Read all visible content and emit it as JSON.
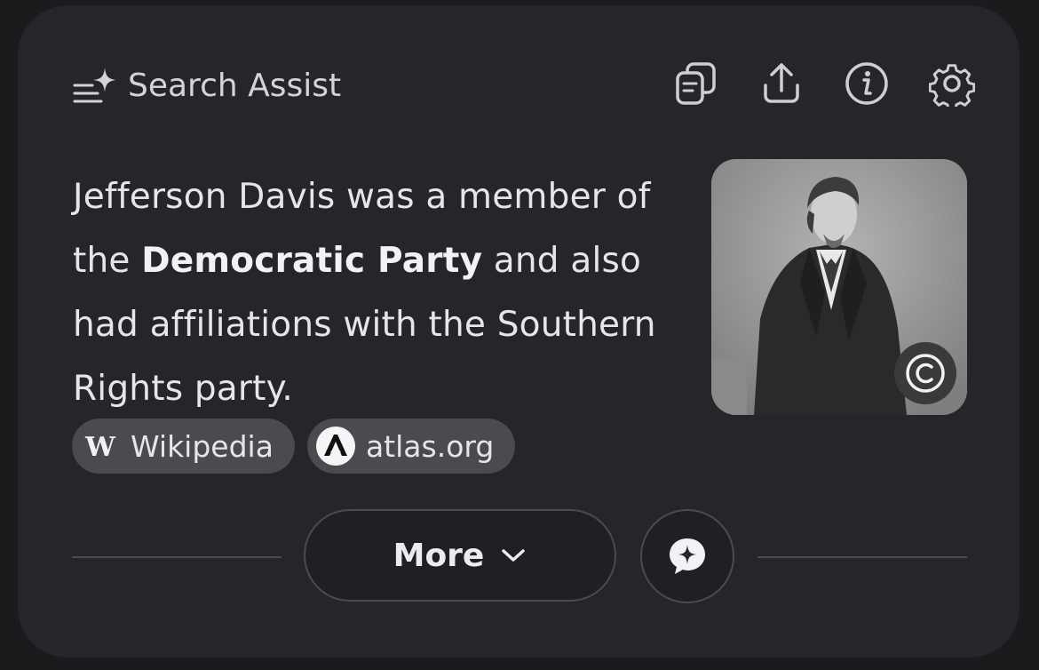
{
  "header": {
    "title": "Search Assist",
    "icons": [
      "sparkle-list-icon",
      "copy-icon",
      "share-icon",
      "info-icon",
      "settings-icon"
    ]
  },
  "answer": {
    "text_before": "Jefferson Davis was a member of the ",
    "bold": "Democratic Party",
    "text_after": " and also had affiliations with the Southern Rights party."
  },
  "image": {
    "subject": "Portrait photograph of Jefferson Davis",
    "badge_icon": "copyright-icon"
  },
  "sources": [
    {
      "label": "Wikipedia",
      "icon": "wikipedia-icon"
    },
    {
      "label": "atlas.org",
      "icon": "atlas-icon"
    }
  ],
  "footer": {
    "more_label": "More",
    "more_icon": "chevron-down-icon",
    "chat_icon": "chat-sparkle-icon"
  },
  "colors": {
    "background": "#1b1b1d",
    "card": "#25262a",
    "chip": "#4a4b50",
    "text": "#e6e6ea"
  }
}
